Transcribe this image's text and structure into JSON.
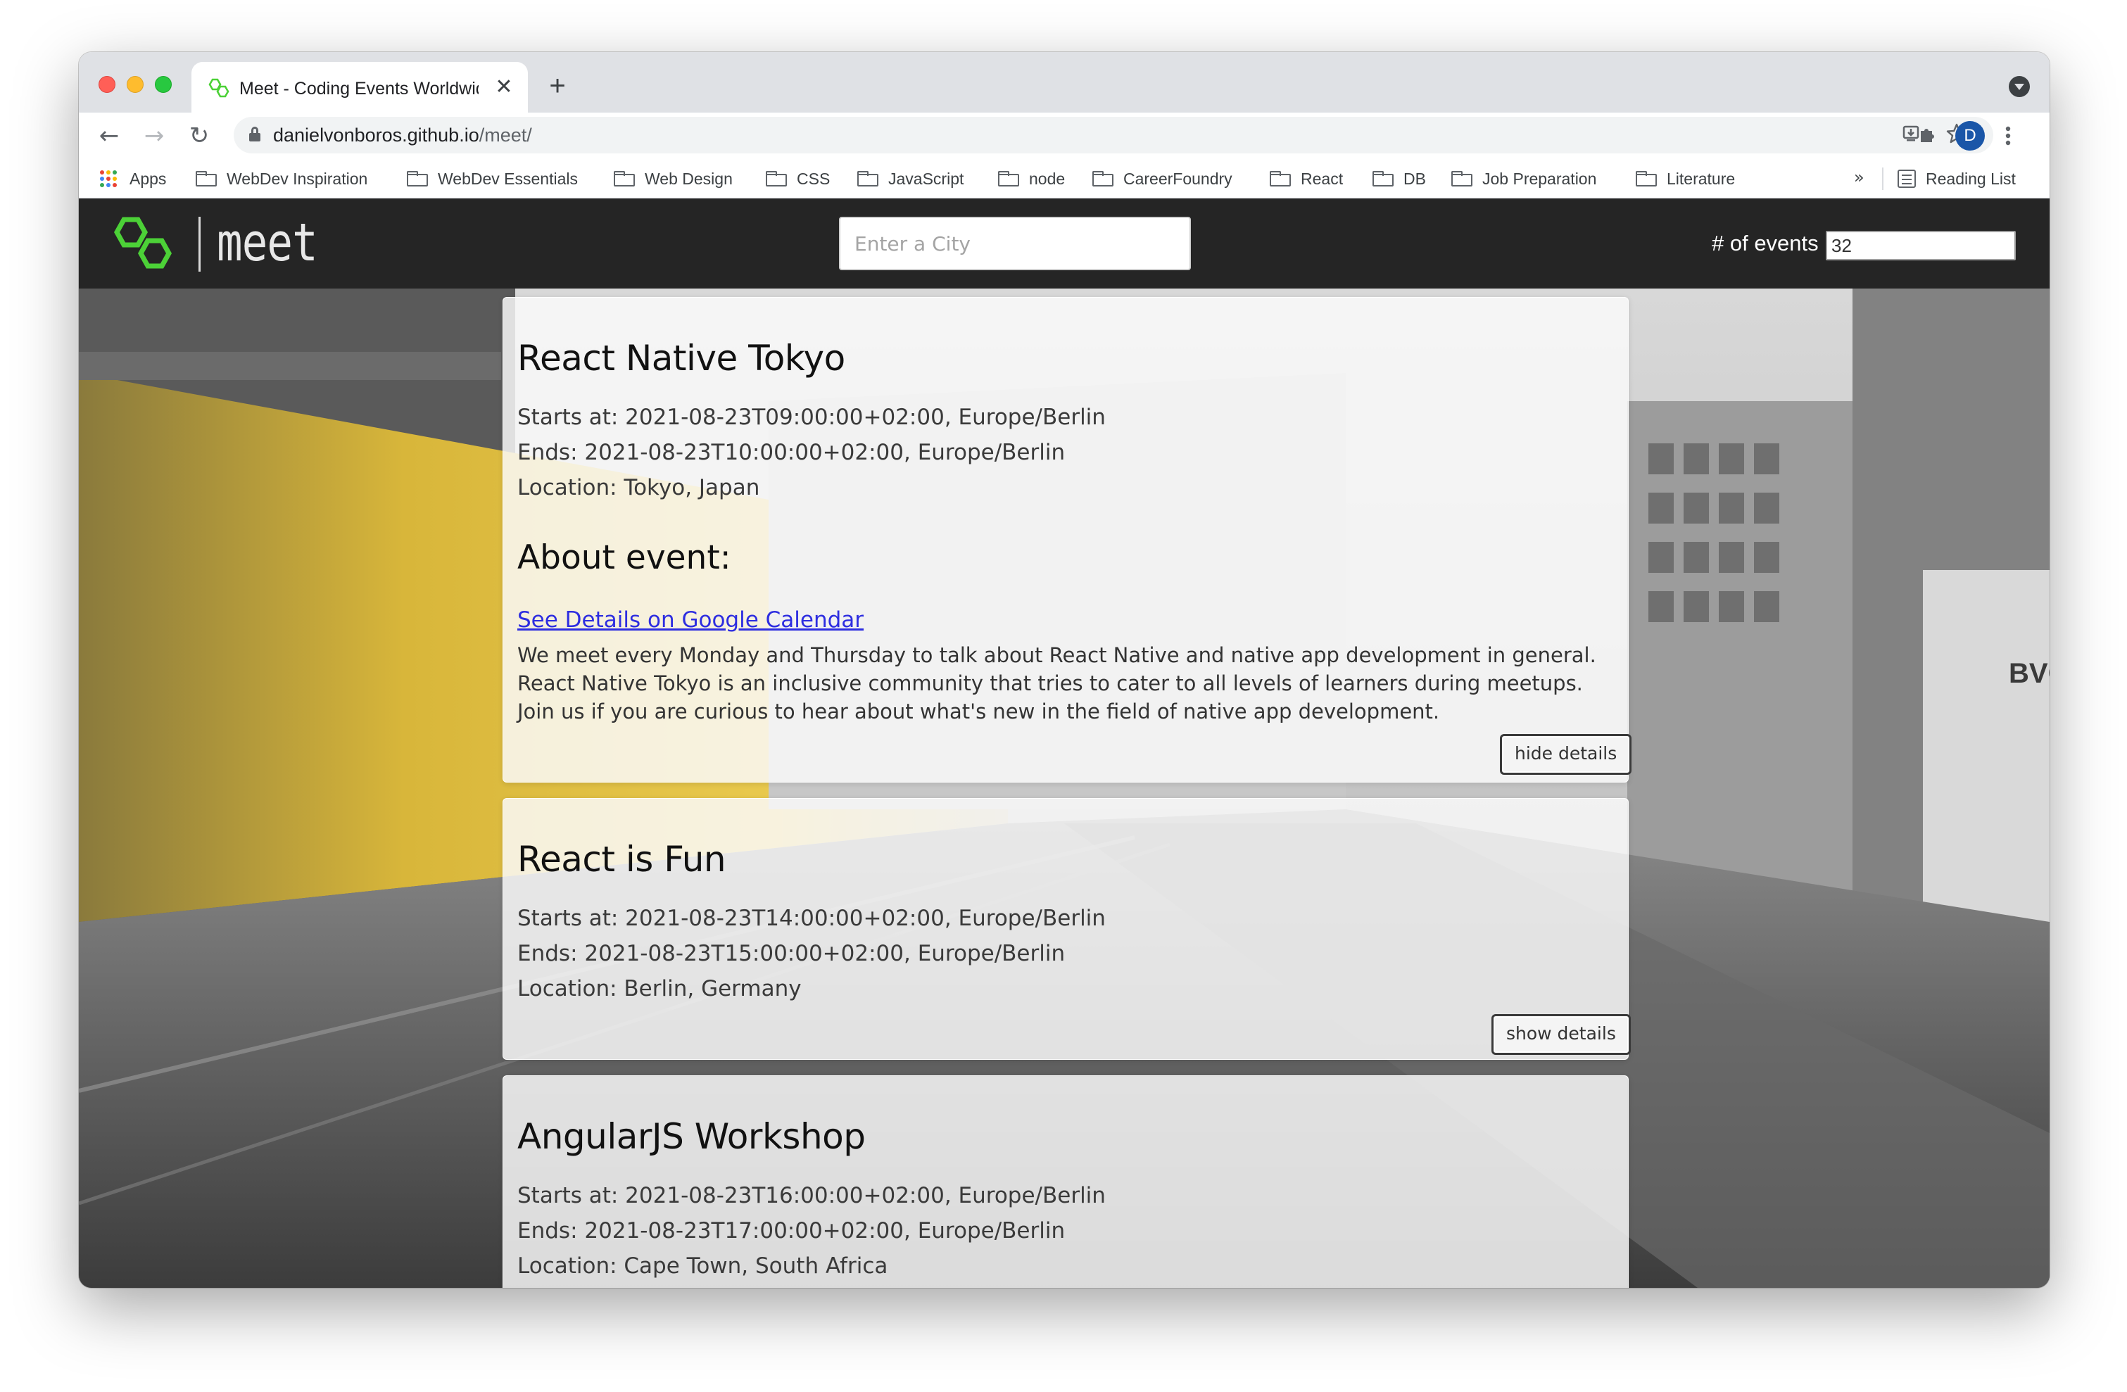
{
  "browser": {
    "tab": {
      "title": "Meet - Coding Events Worldwide",
      "close_glyph": "✕"
    },
    "new_tab_glyph": "+",
    "nav": {
      "back_glyph": "←",
      "forward_glyph": "→",
      "reload_glyph": "↻"
    },
    "url": {
      "host": "danielvonboros.github.io",
      "path": "/meet/"
    },
    "profile_initial": "D",
    "icons": [
      "lock-icon",
      "install-icon",
      "star-icon",
      "extensions-icon",
      "kebab-menu-icon"
    ],
    "bookmarks": {
      "apps_label": "Apps",
      "items": [
        "WebDev Inspiration",
        "WebDev Essentials",
        "Web Design",
        "CSS",
        "JavaScript",
        "node",
        "CareerFoundry",
        "React",
        "DB",
        "Job Preparation",
        "Literature"
      ],
      "overflow": "»",
      "reading_list": "Reading List"
    }
  },
  "app": {
    "logo_text": "meet",
    "logo_color": "#4cd137",
    "search": {
      "placeholder": "Enter a City",
      "value": ""
    },
    "events_count": {
      "label": "# of events",
      "value": "32"
    }
  },
  "events": [
    {
      "title": "React Native Tokyo",
      "starts": "Starts at: 2021-08-23T09:00:00+02:00, Europe/Berlin",
      "ends": "Ends: 2021-08-23T10:00:00+02:00, Europe/Berlin",
      "location": "Location: Tokyo, Japan",
      "about_title": "About event:",
      "link": "See Details on Google Calendar",
      "description": [
        "We meet every Monday and Thursday to talk about React Native and native app development in general.",
        "React Native Tokyo is an inclusive community that tries to cater to all levels of learners during meetups.",
        "Join us if you are curious to hear about what's new in the field of native app development."
      ],
      "button": "hide details"
    },
    {
      "title": "React is Fun",
      "starts": "Starts at: 2021-08-23T14:00:00+02:00, Europe/Berlin",
      "ends": "Ends: 2021-08-23T15:00:00+02:00, Europe/Berlin",
      "location": "Location: Berlin, Germany",
      "button": "show details"
    },
    {
      "title": "AngularJS Workshop",
      "starts": "Starts at: 2021-08-23T16:00:00+02:00, Europe/Berlin",
      "ends": "Ends: 2021-08-23T17:00:00+02:00, Europe/Berlin",
      "location": "Location: Cape Town, South Africa"
    }
  ],
  "background_sign": "BVG"
}
